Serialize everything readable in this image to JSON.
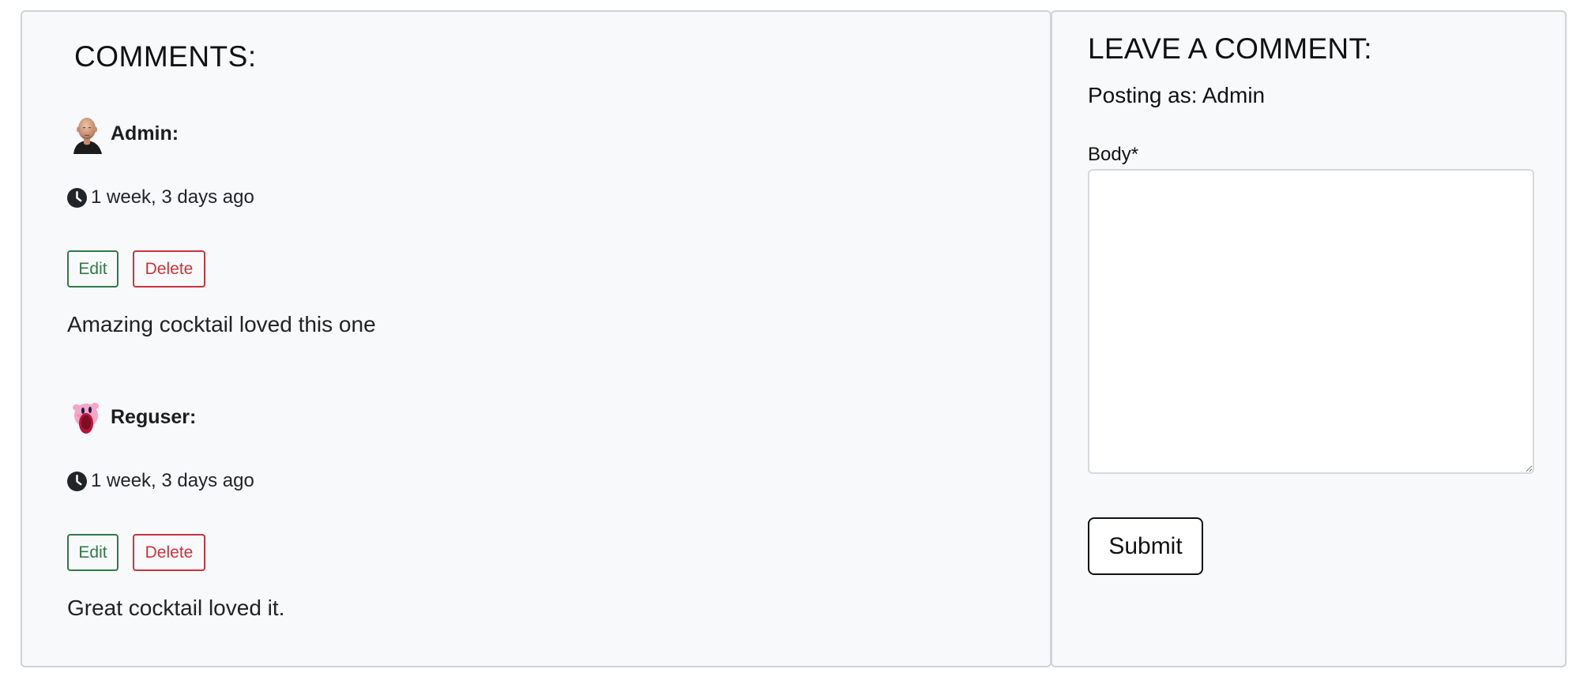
{
  "comments_section": {
    "title": "COMMENTS:",
    "comments": [
      {
        "author": "Admin:",
        "avatar_icon": "bald-man-avatar",
        "time_icon": "clock-icon",
        "time": "1 week, 3 days ago",
        "edit_label": "Edit",
        "delete_label": "Delete",
        "body": "Amazing cocktail loved this one"
      },
      {
        "author": "Reguser:",
        "avatar_icon": "pink-kirby-avatar",
        "time_icon": "clock-icon",
        "time": "1 week, 3 days ago",
        "edit_label": "Edit",
        "delete_label": "Delete",
        "body": "Great cocktail loved it."
      }
    ]
  },
  "leave_comment": {
    "title": "LEAVE A COMMENT:",
    "posting_as": "Posting as: Admin",
    "body_label": "Body*",
    "body_value": "",
    "submit_label": "Submit"
  },
  "colors": {
    "panel_bg": "#f8f9fa",
    "panel_border": "#cfd3d7",
    "edit": "#2f7a48",
    "delete": "#c8323e"
  }
}
